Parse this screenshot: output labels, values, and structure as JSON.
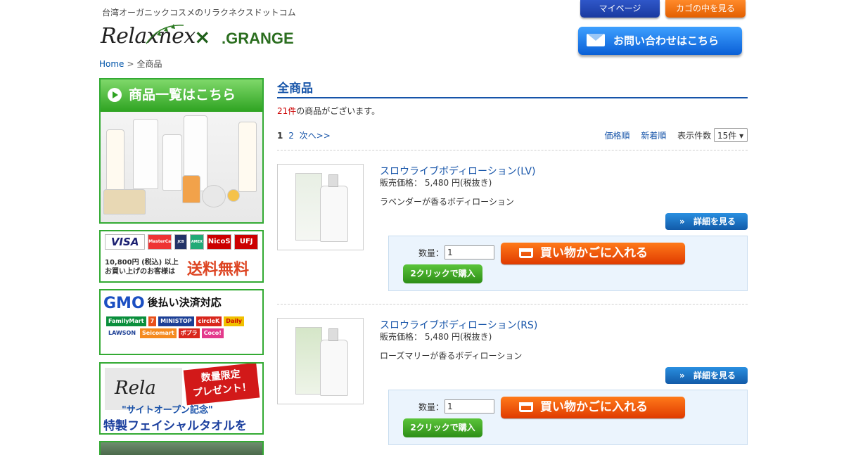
{
  "header": {
    "tagline": "台湾オーガニックコスメのリラクネクスドットコム",
    "logo_relax": "Relaxnex",
    "logo_x": "×",
    "logo_grange": ".GRANGE",
    "mypage": "マイページ",
    "cart": "カゴの中を見る",
    "contact": "お問い合わせはこちら"
  },
  "breadcrumb": {
    "home": "Home",
    "sep": ">",
    "current": "全商品"
  },
  "sidebar": {
    "list_banner": "商品一覧はこちら",
    "cards": [
      "VISA",
      "MasterCard",
      "JCB",
      "AMEX",
      "NicoS",
      "UFJ"
    ],
    "shipping_note": "10,800円 (税込) 以上\nお買い上げのお客様は",
    "shipping_free": "送料無料",
    "gmo": "GMO",
    "gmo_sub": "後払い決済対応",
    "stores": [
      "FamilyMart",
      "7",
      "MINISTOP",
      "circleK",
      "Daily",
      "LAWSON",
      "Seicomart",
      "ポプラ",
      "Coco!"
    ],
    "gift_rela": "Rela",
    "gift_limited": "数量限定\nプレゼント！",
    "gift_open": "\"サイトオープン記念\"",
    "gift_towel": "特製フェイシャルタオルを"
  },
  "main": {
    "title": "全商品",
    "count_num": "21件",
    "count_text": "の商品がございます。",
    "pager": [
      "1",
      "2",
      "次へ>>"
    ],
    "sort_price": "価格順",
    "sort_new": "新着順",
    "per_page_label": "表示件数",
    "per_page_value": "15件 ▾",
    "products": [
      {
        "name": "スロウライブボディローション(LV)",
        "price": "販売価格： 5,480 円(税抜き)",
        "desc": "ラベンダーが香るボディローション",
        "detail": "詳細を見る",
        "qty_label": "数量：",
        "qty": "1",
        "add_cart": "買い物かごに入れる",
        "one_click": "2クリックで購入"
      },
      {
        "name": "スロウライブボディローション(RS)",
        "price": "販売価格： 5,480 円(税抜き)",
        "desc": "ローズマリーが香るボディローション",
        "detail": "詳細を見る",
        "qty_label": "数量：",
        "qty": "1",
        "add_cart": "買い物かごに入れる",
        "one_click": "2クリックで購入"
      }
    ]
  },
  "icons": {
    "chevron": "»",
    "mail": "mail-icon",
    "cart": "cart-icon",
    "play": "play-icon"
  }
}
